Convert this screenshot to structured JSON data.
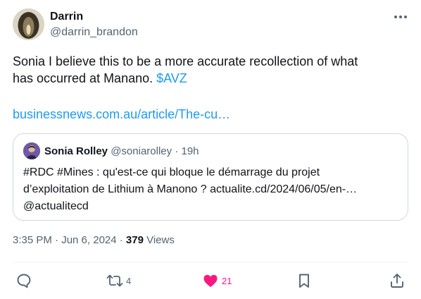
{
  "tweet": {
    "author_name": "Darrin",
    "author_handle": "@darrin_brandon",
    "text_line1": "Sonia I believe this to be a more accurate recollection of what",
    "text_line2_prefix": "has occurred at Manano. ",
    "cashtag": "$AVZ",
    "link": "businessnews.com.au/article/The-cu…"
  },
  "quote": {
    "author_name": "Sonia Rolley",
    "author_handle": "@soniarolley",
    "time": "· 19h",
    "line1": "#RDC #Mines : qu'est-ce qui bloque le démarrage du projet",
    "line2": "d’exploitation de Lithium à Manono ? actualite.cd/2024/06/05/en-…",
    "line3": "@actualitecd"
  },
  "meta": {
    "timestamp": "3:35 PM · Jun 6, 2024 · ",
    "views_count": "379",
    "views_label": " Views"
  },
  "actions": {
    "retweets": "4",
    "likes": "21"
  },
  "colors": {
    "accent": "#1d9bf0",
    "like": "#f91880",
    "secondary_text": "#536471"
  },
  "icons": [
    "more-icon",
    "reply-icon",
    "retweet-icon",
    "like-icon",
    "bookmark-icon",
    "share-icon"
  ]
}
